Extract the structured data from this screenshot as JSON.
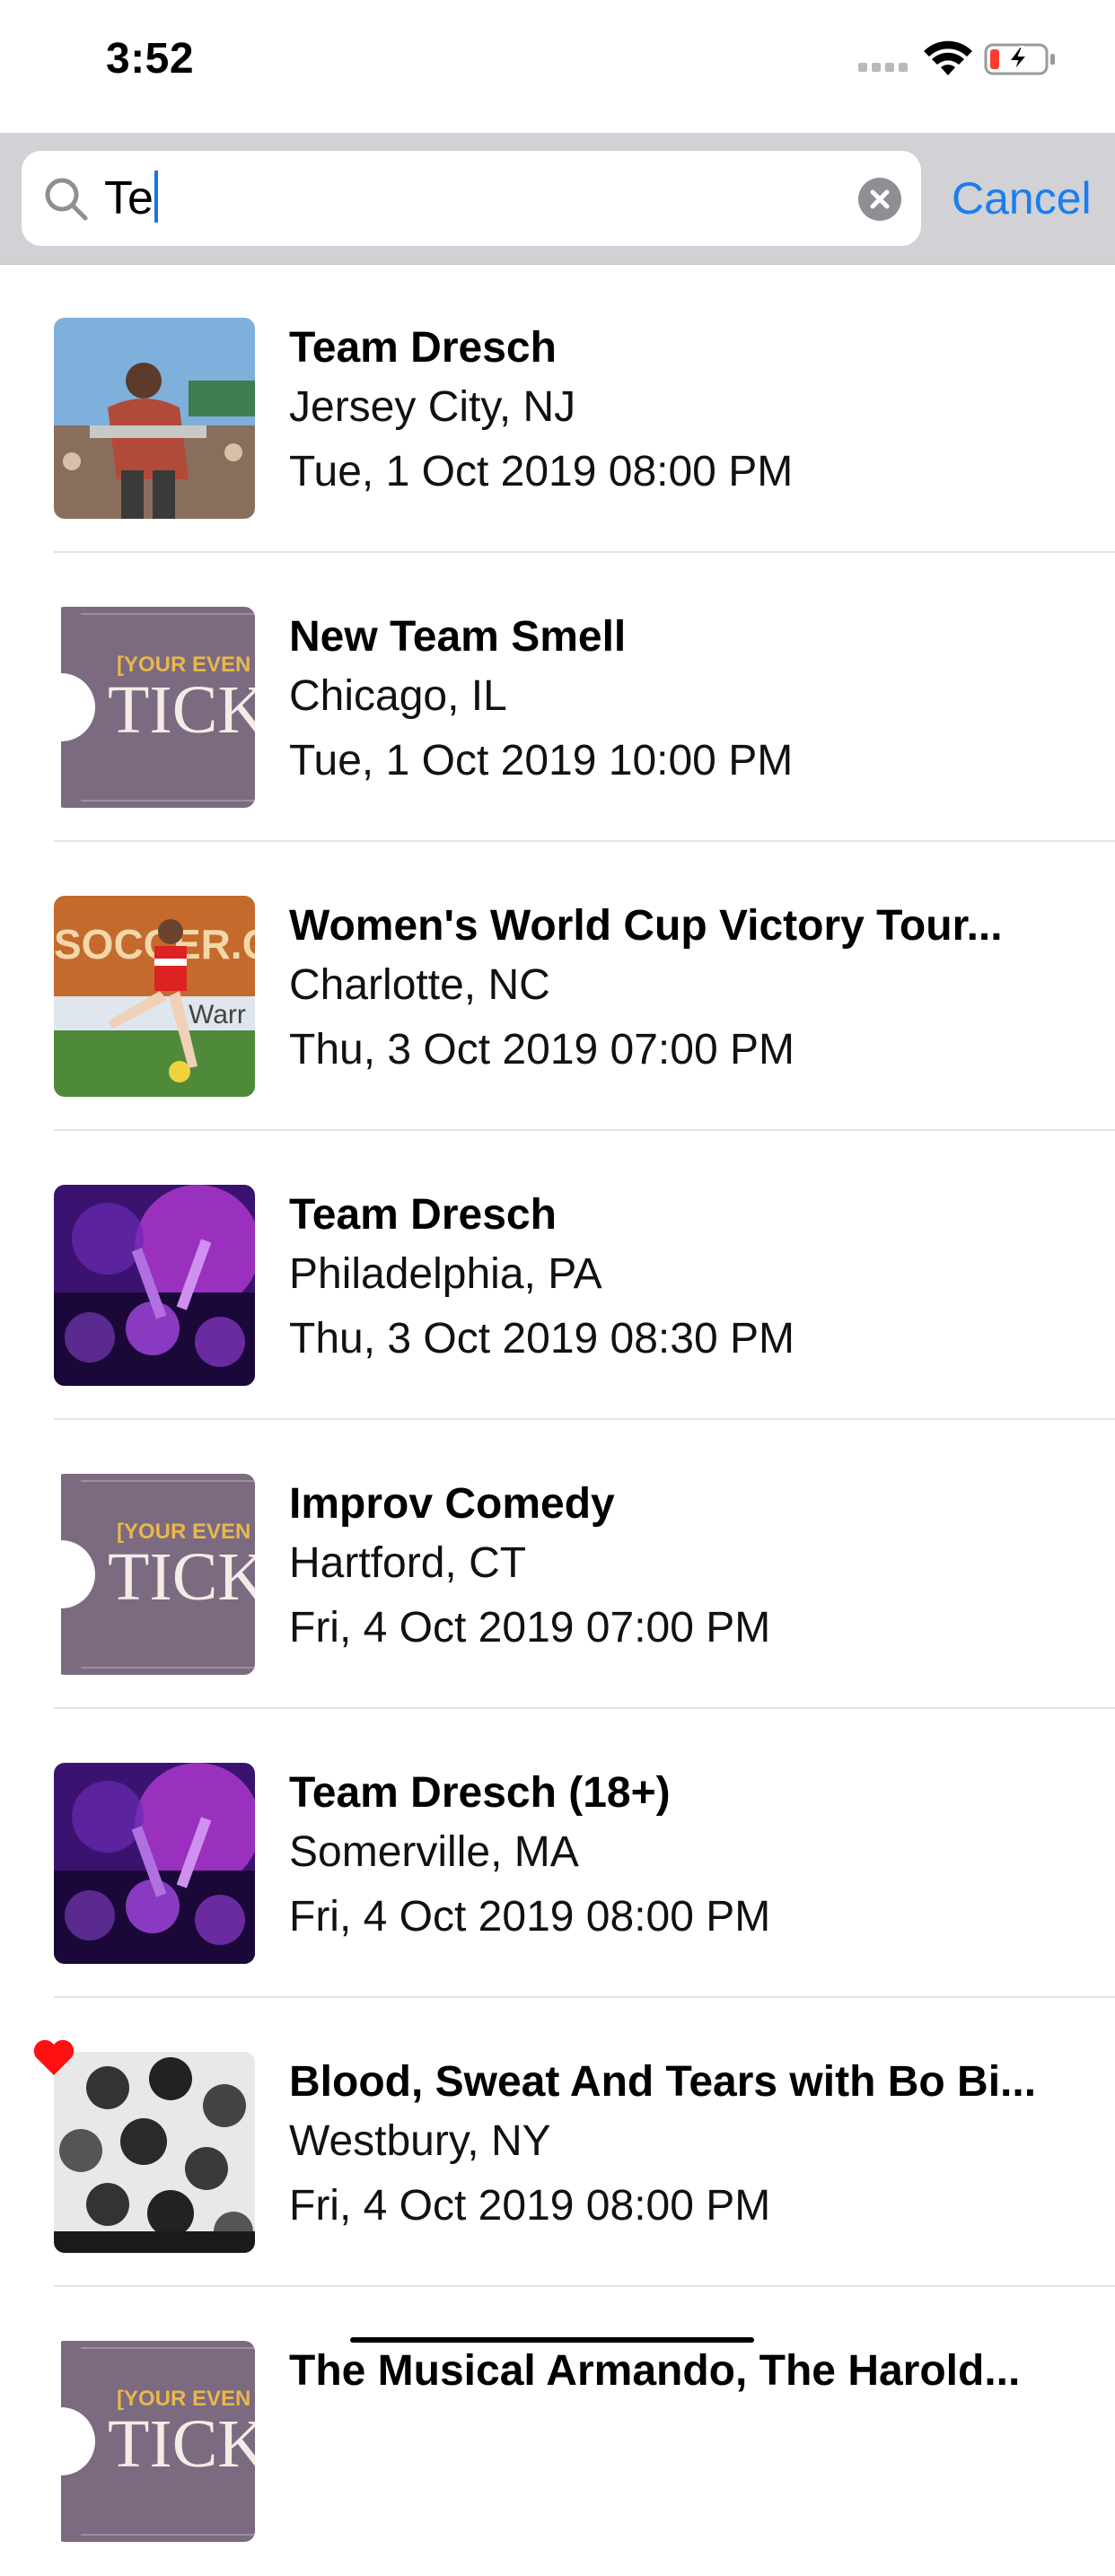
{
  "status": {
    "time": "3:52"
  },
  "search": {
    "query": "Te",
    "cancel_label": "Cancel"
  },
  "events": [
    {
      "title": "Team Dresch",
      "location": "Jersey City, NJ",
      "datetime": "Tue, 1 Oct 2019 08:00 PM",
      "thumb": "photo-performer"
    },
    {
      "title": "New Team Smell",
      "location": "Chicago, IL",
      "datetime": "Tue, 1 Oct 2019 10:00 PM",
      "thumb": "ticket",
      "ticket_top": "[YOUR EVEN",
      "ticket_main": "TICK"
    },
    {
      "title": "Women's World Cup Victory Tour...",
      "location": "Charlotte, NC",
      "datetime": "Thu, 3 Oct 2019 07:00 PM",
      "thumb": "photo-soccer",
      "photo_text1": "SOCCER.COM",
      "photo_text2": "Warr"
    },
    {
      "title": "Team Dresch",
      "location": "Philadelphia, PA",
      "datetime": "Thu, 3 Oct 2019 08:30 PM",
      "thumb": "photo-concert"
    },
    {
      "title": "Improv Comedy",
      "location": "Hartford, CT",
      "datetime": "Fri, 4 Oct 2019 07:00 PM",
      "thumb": "ticket",
      "ticket_top": "[YOUR EVEN",
      "ticket_main": "TICK"
    },
    {
      "title": "Team Dresch (18+)",
      "location": "Somerville, MA",
      "datetime": "Fri, 4 Oct 2019 08:00 PM",
      "thumb": "photo-concert"
    },
    {
      "title": "Blood, Sweat And Tears with Bo Bi...",
      "location": "Westbury, NY",
      "datetime": "Fri, 4 Oct 2019 08:00 PM",
      "thumb": "photo-band",
      "favorite": true
    },
    {
      "title": "The Musical Armando, The Harold...",
      "location": "",
      "datetime": "",
      "thumb": "ticket",
      "ticket_top": "[YOUR EVEN",
      "ticket_main": "TICK"
    }
  ],
  "colors": {
    "accent": "#1a7ef0",
    "heart": "#ff1010",
    "ticket": "#7b6a80",
    "ticket_text": "#e8b84a"
  }
}
